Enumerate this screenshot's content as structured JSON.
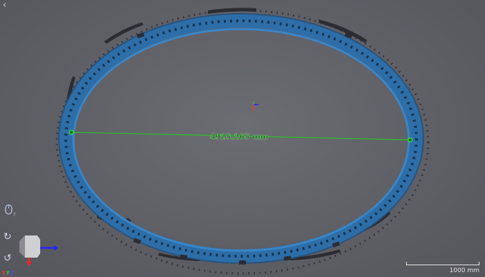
{
  "measurement": {
    "label": "4925.265 mm"
  },
  "scale": {
    "label": "1000 mm"
  },
  "navigation": {
    "back_glyph": "‹"
  },
  "controls": {
    "rotate_cw_glyph": "↻",
    "rotate_ccw_glyph": "↺"
  },
  "axes": {
    "x": "X",
    "y": "Y",
    "z": "Z"
  },
  "icons": [
    "back-icon",
    "mouse-help-icon",
    "rotate-cw-icon",
    "rotate-ccw-icon",
    "view-cube-icon"
  ],
  "colors": {
    "ring": "#2e6ea8",
    "ring_dark": "#1f4f7c",
    "measure_line": "#29c429",
    "measure_text": "#2a8a2a",
    "axis_x": "#ff3030",
    "axis_y": "#33cc33",
    "axis_z": "#2222ff"
  }
}
